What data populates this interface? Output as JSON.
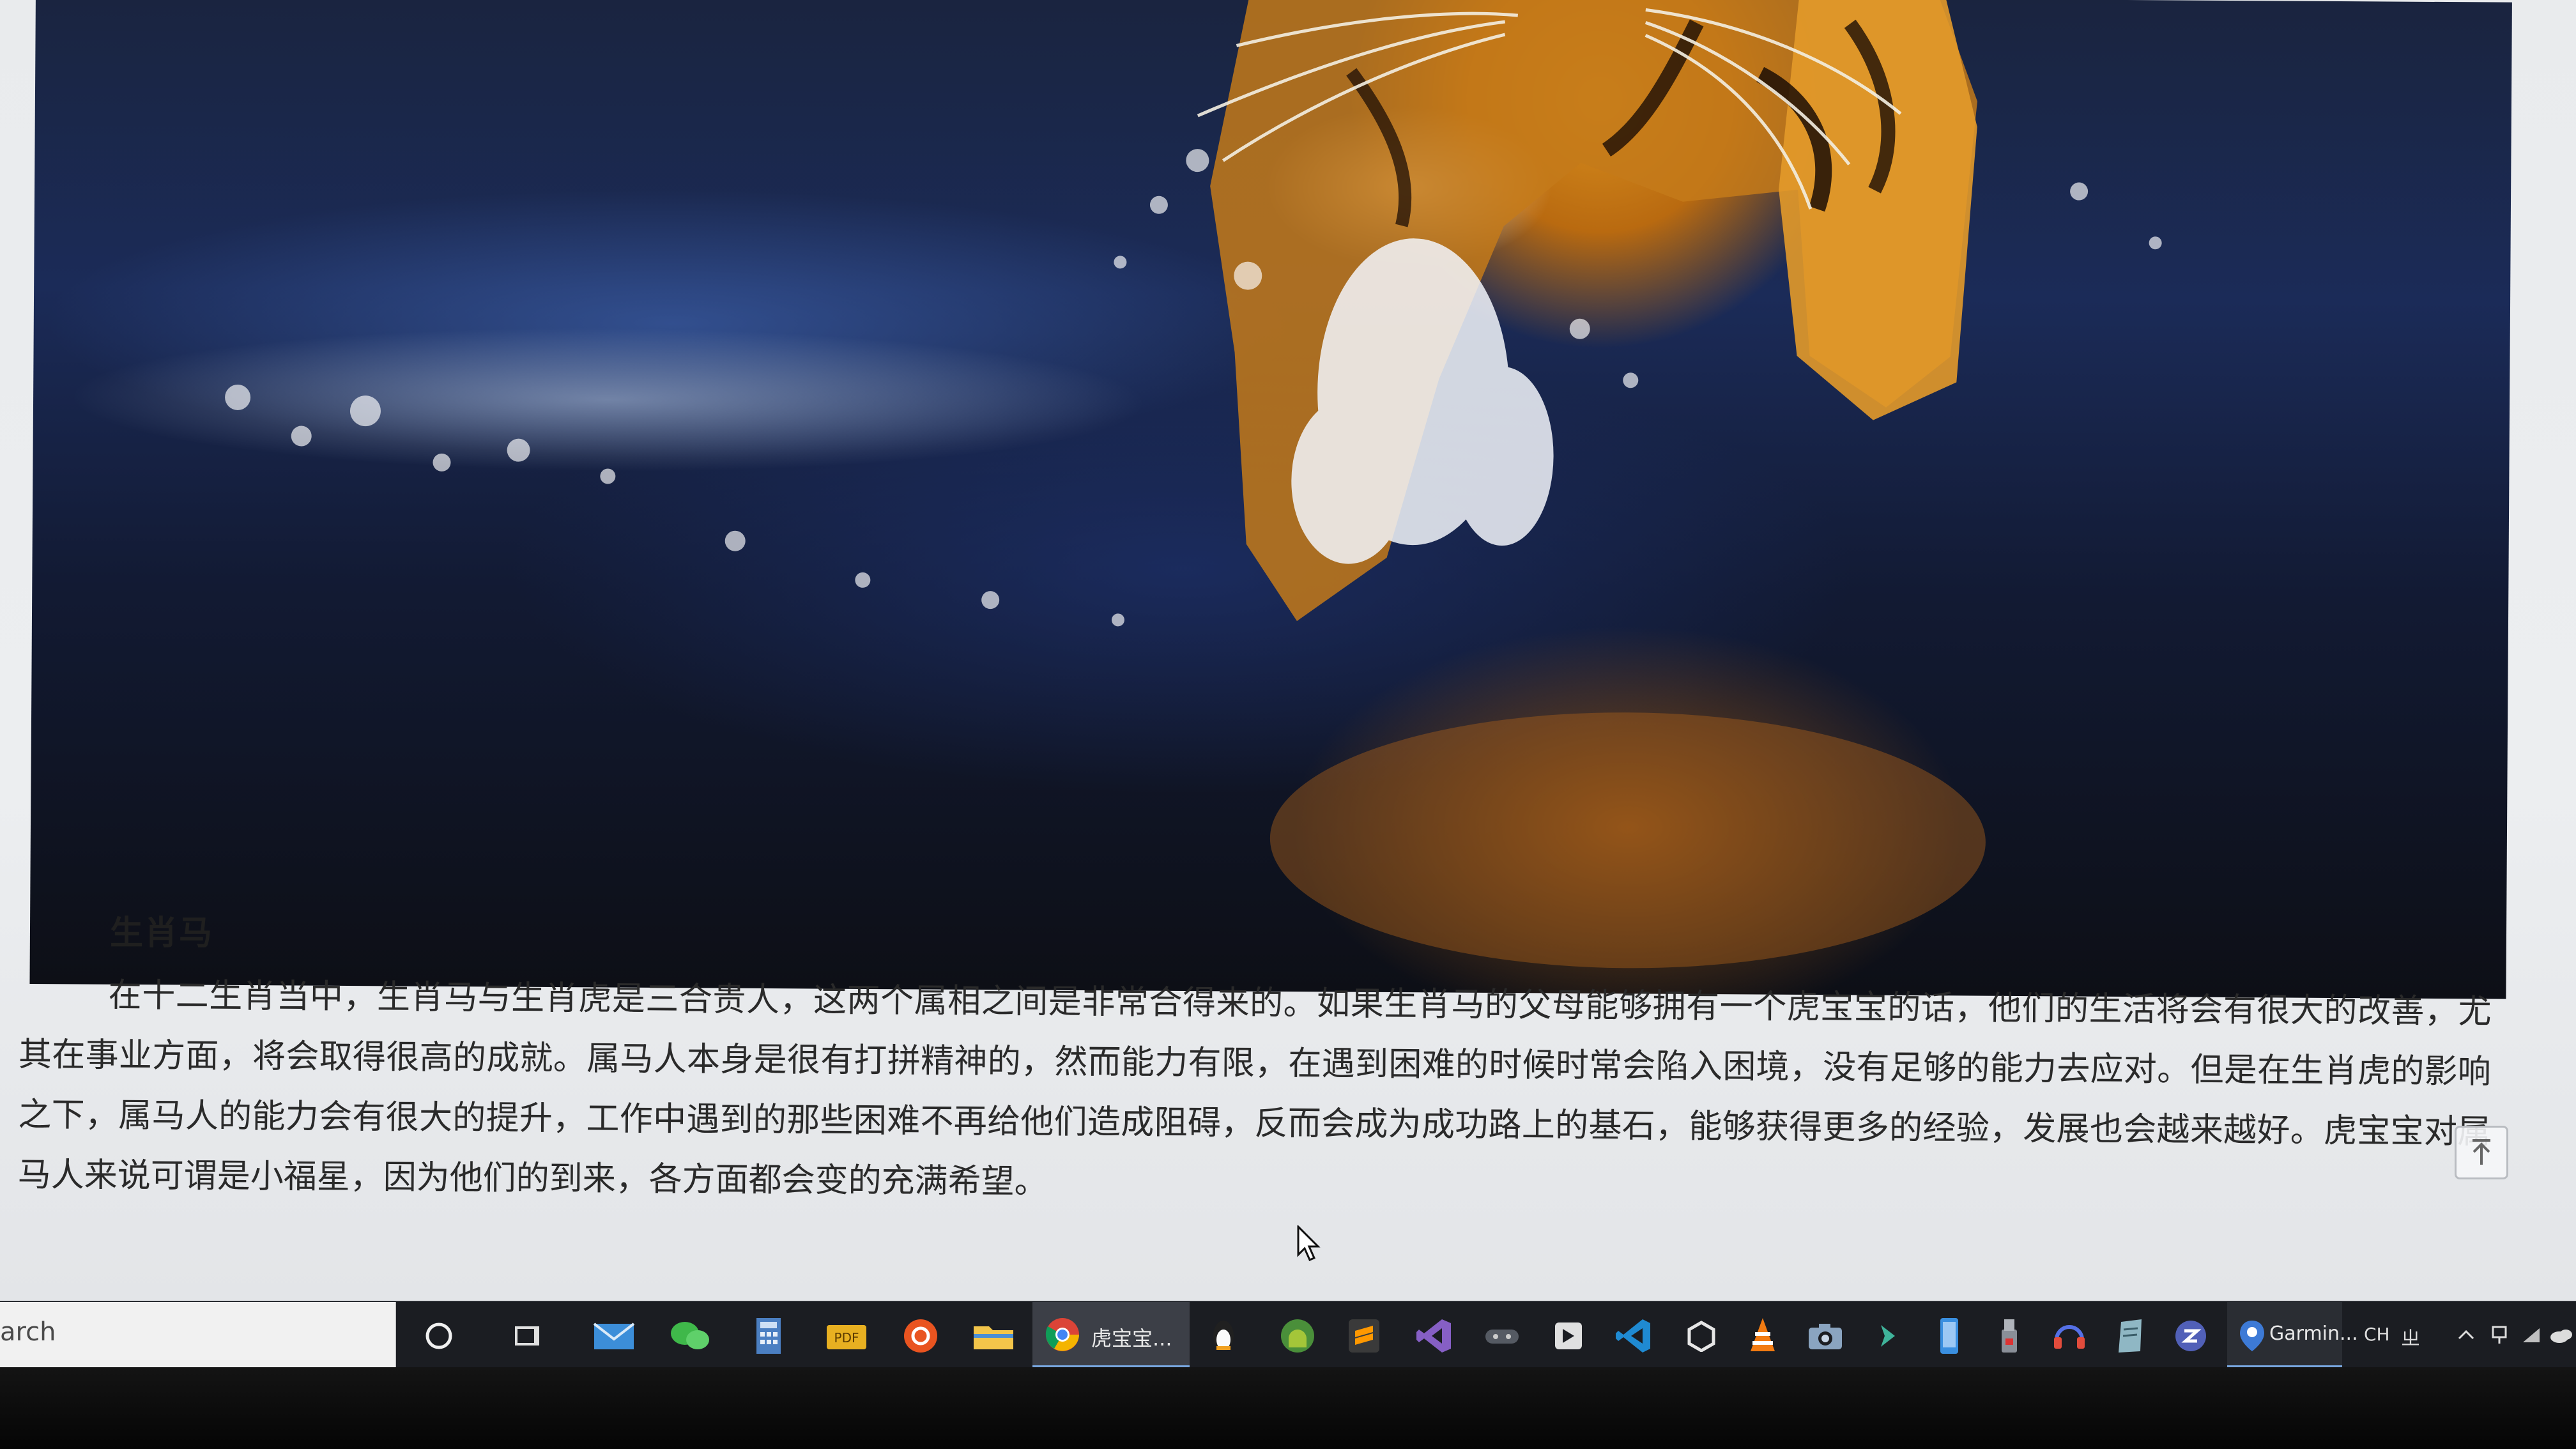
{
  "article": {
    "heading": "生肖马",
    "body": "在十二生肖当中，生肖马与生肖虎是三合贵人，这两个属相之间是非常合得来的。如果生肖马的父母能够拥有一个虎宝宝的话，他们的生活将会有很大的改善，尤其在事业方面，将会取得很高的成就。属马人本身是很有打拼精神的，然而能力有限，在遇到困难的时候时常会陷入困境，没有足够的能力去应对。但是在生肖虎的影响之下，属马人的能力会有很大的提升，工作中遇到的那些困难不再给他们造成阻碍，反而会成为成功路上的基石，能够获得更多的经验，发展也会越来越好。虎宝宝对属马人来说可谓是小福星，因为他们的到来，各方面都会变的充满希望。"
  },
  "taskbar": {
    "search_text": "arch",
    "chrome_task_label": "虎宝宝...",
    "garmin_task_label": "Garmin...",
    "language": "CH",
    "ime": "ㄓ",
    "icons": [
      "cortana-circle-icon",
      "task-view-icon",
      "mail-icon",
      "wechat-icon",
      "calculator-icon",
      "pdf-icon",
      "ubuntu-icon",
      "file-explorer-icon",
      "chrome-icon",
      "qq-penguin-icon",
      "android-icon",
      "sublime-icon",
      "visual-studio-icon",
      "gamepad-icon",
      "app-icon",
      "vscode-icon",
      "unity-icon",
      "vlc-icon",
      "camera-icon",
      "arrow-app-icon",
      "phone-icon",
      "usb-icon",
      "headset-icon",
      "notes-icon",
      "e-app-icon",
      "garmin-icon"
    ]
  },
  "colors": {
    "page_bg": "#eceef0",
    "text": "#2a2a2a",
    "taskbar": "#1b1d22",
    "accent": "#79a7e0"
  }
}
